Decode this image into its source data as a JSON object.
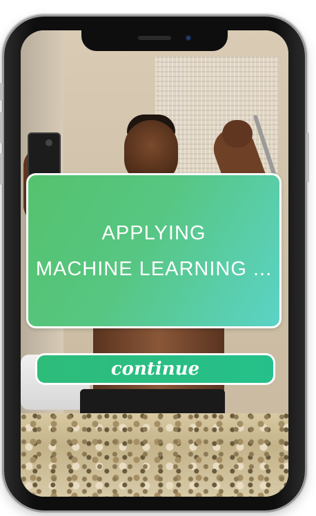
{
  "dialog": {
    "line1": "APPLYING",
    "line2": "MACHINE LEARNING ..."
  },
  "continue_button": {
    "label": "continue"
  },
  "colors": {
    "dialog_gradient_start": "#55c26e",
    "dialog_gradient_end": "#5bd3c6",
    "button_green": "#2ebc7a",
    "border": "#ffffff"
  }
}
